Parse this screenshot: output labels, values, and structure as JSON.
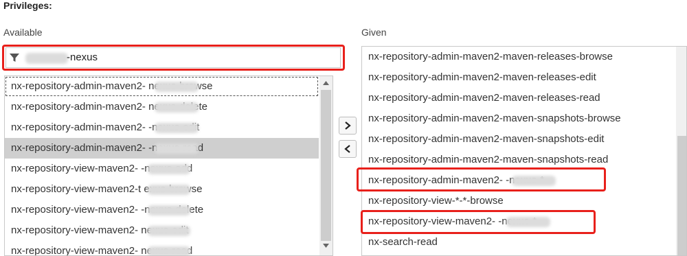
{
  "section_title": "Privileges:",
  "available": {
    "label": "Available",
    "filter_value": "-nexus",
    "items": [
      {
        "label": "nx-repository-admin-maven2-              nexus-browse"
      },
      {
        "label": "nx-repository-admin-maven2-              nexus-delete"
      },
      {
        "label": "nx-repository-admin-maven2-              -nexus-edit"
      },
      {
        "label": "nx-repository-admin-maven2-              -nexus-read"
      },
      {
        "label": "nx-repository-view-maven2-              -nexus-add"
      },
      {
        "label": "nx-repository-view-maven2-t             exus-browse"
      },
      {
        "label": "nx-repository-view-maven2-              -nexus-delete"
      },
      {
        "label": "nx-repository-view-maven2-              nexus-edit"
      },
      {
        "label": "nx-repository-view-maven2-              nexus-read"
      }
    ]
  },
  "given": {
    "label": "Given",
    "items": [
      {
        "label": "nx-repository-admin-maven2-maven-releases-browse"
      },
      {
        "label": "nx-repository-admin-maven2-maven-releases-edit"
      },
      {
        "label": "nx-repository-admin-maven2-maven-releases-read"
      },
      {
        "label": "nx-repository-admin-maven2-maven-snapshots-browse"
      },
      {
        "label": "nx-repository-admin-maven2-maven-snapshots-edit"
      },
      {
        "label": "nx-repository-admin-maven2-maven-snapshots-read"
      },
      {
        "label": "nx-repository-admin-maven2-              -nexus-*"
      },
      {
        "label": "nx-repository-view-*-*-browse"
      },
      {
        "label": "nx-repository-view-maven2-              -nexus-*"
      },
      {
        "label": "nx-search-read"
      }
    ]
  },
  "colors": {
    "highlight": "#e8201b",
    "selected_row": "#cfcfcf"
  },
  "icons": {
    "filter": "funnel-icon",
    "add": "chevron-right-icon",
    "remove": "chevron-left-icon"
  }
}
